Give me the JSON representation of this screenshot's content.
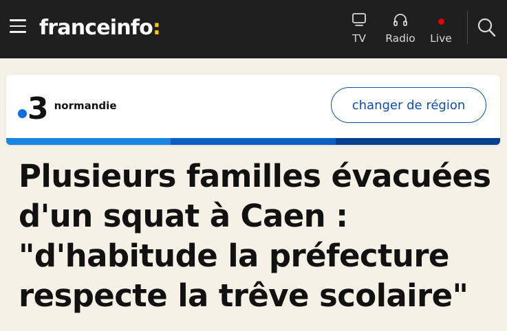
{
  "header": {
    "menu_icon": "hamburger-menu-icon",
    "logo_text": "franceinfo",
    "logo_colon": ":",
    "nav": [
      {
        "label": "TV",
        "icon": "tv-icon"
      },
      {
        "label": "Radio",
        "icon": "headphones-icon"
      },
      {
        "label": "Live",
        "icon": "live-dot-icon"
      }
    ],
    "search_icon": "search-icon"
  },
  "region": {
    "channel_number": "3",
    "region_name": "normandie",
    "change_button_label": "changer de région"
  },
  "article": {
    "headline_lines": [
      "Plusieurs familles évacuées",
      "d'un squat à Caen :",
      "\"d'habitude la préfecture",
      "respecte la trêve scolaire\""
    ]
  },
  "colors": {
    "header_bg": "#1f1f1f",
    "page_bg": "#f6f1e7",
    "logo_colon": "#ffc700",
    "live_dot": "#e20000",
    "region_dot": "#0f6ee0",
    "button_border": "#0f4ea8",
    "stripes": [
      "#1a86e2",
      "#0a5fc4",
      "#033f8f"
    ]
  }
}
